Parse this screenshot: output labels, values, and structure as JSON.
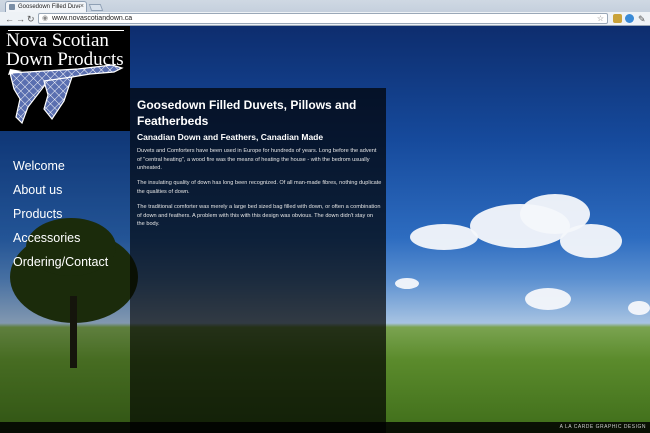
{
  "browser": {
    "tab_title": "Goosedown Filled Duvets, P",
    "tab_close": "×",
    "back": "←",
    "forward": "→",
    "reload": "↻",
    "url": "www.novascotiandown.ca",
    "star": "☆"
  },
  "logo": {
    "line1": "Nova Scotian",
    "line2": "Down Products"
  },
  "nav": {
    "items": [
      "Welcome",
      "About us",
      "Products",
      "Accessories",
      "Ordering/Contact"
    ]
  },
  "content": {
    "title": "Goosedown Filled Duvets, Pillows and Featherbeds",
    "subtitle": "Canadian Down and Feathers, Canadian Made",
    "paragraphs": [
      "Duvets and Comforters have been used in Europe for hundreds of years. Long before the advent of \"central heating\", a wood fire was the means of heating the house - with the bedrom usually unheated.",
      "The insulating quality of down has long been recognized. Of all man-made fibres, nothing duplicate the qualities of down.",
      "The traditional comforter was merely a large bed sized bag filled with down, or often a combination of down and feathers. A problem with this with this design was obvious. The down didn't stay on the body."
    ]
  },
  "footer": {
    "credit": "A LA CARDE GRAPHIC DESIGN"
  },
  "colors": {
    "sky": "#164a9c",
    "grass": "#5b8b2c",
    "panel": "#000000"
  }
}
